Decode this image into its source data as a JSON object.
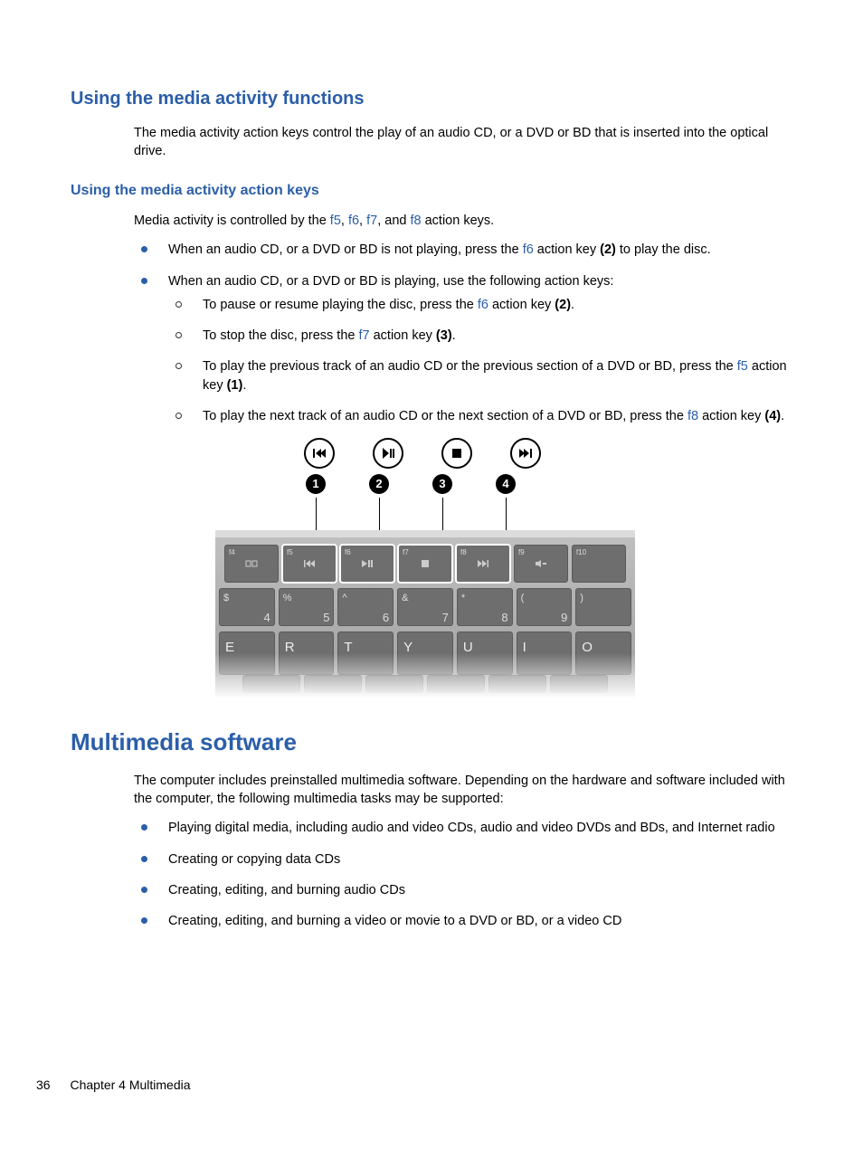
{
  "section1": {
    "title": "Using the media activity functions",
    "intro": "The media activity action keys control the play of an audio CD, or a DVD or BD that is inserted into the optical drive."
  },
  "sub1": {
    "title": "Using the media activity action keys",
    "intro_pre": "Media activity is controlled by the ",
    "k1": "f5",
    "c1": ", ",
    "k2": "f6",
    "c2": ", ",
    "k3": "f7",
    "c3": ", and ",
    "k4": "f8",
    "intro_post": " action keys.",
    "b1_pre": "When an audio CD, or a DVD or BD is not playing, press the ",
    "b1_key": "f6",
    "b1_mid": " action key ",
    "b1_num": "(2)",
    "b1_post": " to play the disc.",
    "b2": "When an audio CD, or a DVD or BD is playing, use the following action keys:",
    "s1_pre": "To pause or resume playing the disc, press the ",
    "s1_key": "f6",
    "s1_mid": " action key ",
    "s1_num": "(2)",
    "s1_post": ".",
    "s2_pre": "To stop the disc, press the ",
    "s2_key": "f7",
    "s2_mid": " action key ",
    "s2_num": "(3)",
    "s2_post": ".",
    "s3_pre": "To play the previous track of an audio CD or the previous section of a DVD or BD, press the ",
    "s3_key": "f5",
    "s3_mid": " action key ",
    "s3_num": "(1)",
    "s3_post": ".",
    "s4_pre": "To play the next track of an audio CD or the next section of a DVD or BD, press the ",
    "s4_key": "f8",
    "s4_mid": " action key ",
    "s4_num": "(4)",
    "s4_post": "."
  },
  "diagram": {
    "badges": [
      "1",
      "2",
      "3",
      "4"
    ],
    "fn_keys": [
      {
        "label": "f4",
        "glyph": "mirror",
        "hl": false
      },
      {
        "label": "f5",
        "glyph": "prev",
        "hl": true
      },
      {
        "label": "f6",
        "glyph": "playpause",
        "hl": true
      },
      {
        "label": "f7",
        "glyph": "stop",
        "hl": true
      },
      {
        "label": "f8",
        "glyph": "next",
        "hl": true
      },
      {
        "label": "f9",
        "glyph": "voldown",
        "hl": false
      },
      {
        "label": "f10",
        "glyph": "",
        "hl": false
      }
    ],
    "num_keys": [
      {
        "sym": "$",
        "dig": "4"
      },
      {
        "sym": "%",
        "dig": "5"
      },
      {
        "sym": "^",
        "dig": "6"
      },
      {
        "sym": "&",
        "dig": "7"
      },
      {
        "sym": "*",
        "dig": "8"
      },
      {
        "sym": "(",
        "dig": "9"
      },
      {
        "sym": ")",
        "dig": ""
      }
    ],
    "letters": [
      "E",
      "R",
      "T",
      "Y",
      "U",
      "I",
      "O"
    ]
  },
  "section2": {
    "title": "Multimedia software",
    "intro": "The computer includes preinstalled multimedia software. Depending on the hardware and software included with the computer, the following multimedia tasks may be supported:",
    "items": [
      "Playing digital media, including audio and video CDs, audio and video DVDs and BDs, and Internet radio",
      "Creating or copying data CDs",
      "Creating, editing, and burning audio CDs",
      "Creating, editing, and burning a video or movie to a DVD or BD, or a video CD"
    ]
  },
  "footer": {
    "page": "36",
    "chapter": "Chapter 4   Multimedia"
  }
}
